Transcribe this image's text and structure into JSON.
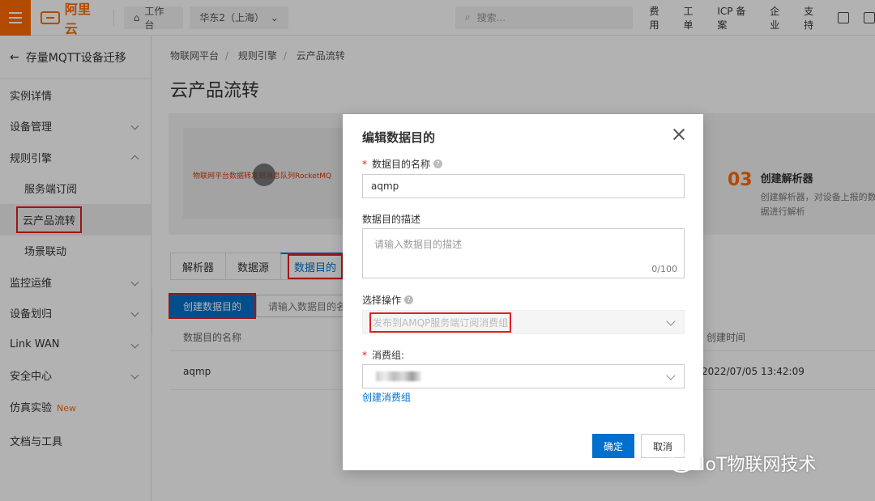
{
  "topbar": {
    "logo": "阿里云",
    "workbench": "工作台",
    "region": "华东2（上海）",
    "search_placeholder": "搜索...",
    "links": [
      "费用",
      "工单",
      "ICP 备案",
      "企业",
      "支持"
    ]
  },
  "sidebar": {
    "back_title": "存量MQTT设备迁移",
    "items": [
      {
        "label": "实例详情"
      },
      {
        "label": "设备管理"
      },
      {
        "label": "规则引擎"
      },
      {
        "label": "服务端订阅"
      },
      {
        "label": "云产品流转"
      },
      {
        "label": "场景联动"
      },
      {
        "label": "监控运维"
      },
      {
        "label": "设备划归"
      },
      {
        "label": "Link WAN"
      },
      {
        "label": "安全中心"
      },
      {
        "label": "仿真实验",
        "badge": "New"
      },
      {
        "label": "文档与工具"
      }
    ]
  },
  "main": {
    "breadcrumb": [
      "物联网平台",
      "规则引擎",
      "云产品流转"
    ],
    "title": "云产品流转",
    "video_text": "物联网平台数据转发到消息队列RocketMQ",
    "step": {
      "num": "03",
      "title": "创建解析器",
      "desc": "创建解析器，对设备上报的数据进行解析"
    },
    "tabs": [
      "解析器",
      "数据源",
      "数据目的"
    ],
    "create_btn": "创建数据目的",
    "search_placeholder": "请输入数据目的名称",
    "columns": [
      "数据目的名称",
      "创建时间"
    ],
    "rows": [
      {
        "name": "aqmp",
        "created": "2022/07/05 13:42:09"
      }
    ]
  },
  "modal": {
    "title": "编辑数据目的",
    "name_label": "数据目的名称",
    "name_value": "aqmp",
    "desc_label": "数据目的描述",
    "desc_placeholder": "请输入数据目的描述",
    "desc_counter": "0/100",
    "op_label": "选择操作",
    "op_value": "发布到AMQP服务端订阅消费组",
    "group_label": "消费组:",
    "create_group_link": "创建消费组",
    "ok": "确定",
    "cancel": "取消"
  },
  "watermark": "IoT物联网技术"
}
